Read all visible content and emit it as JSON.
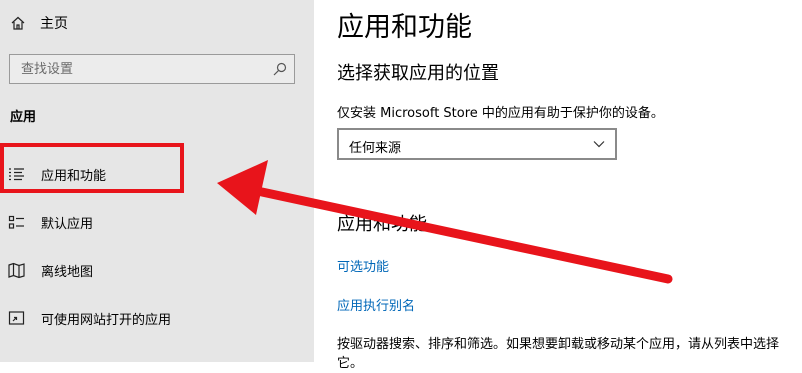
{
  "sidebar": {
    "home": {
      "label": "主页",
      "icon": "home-icon"
    },
    "search": {
      "placeholder": "查找设置",
      "icon": "search-icon"
    },
    "section_title": "应用",
    "items": [
      {
        "label": "应用和功能",
        "icon": "apps-features-icon",
        "selected": true
      },
      {
        "label": "默认应用",
        "icon": "default-apps-icon"
      },
      {
        "label": "离线地图",
        "icon": "offline-maps-icon"
      },
      {
        "label": "可使用网站打开的应用",
        "icon": "apps-for-websites-icon"
      }
    ]
  },
  "main": {
    "title": "应用和功能",
    "install_location": {
      "heading": "选择获取应用的位置",
      "description": "仅安装 Microsoft Store 中的应用有助于保护你的设备。",
      "dropdown_value": "任何来源"
    },
    "apps_section": {
      "heading": "应用和功能",
      "links": [
        "可选功能",
        "应用执行别名"
      ],
      "description": "按驱动器搜索、排序和筛选。如果想要卸载或移动某个应用，请从列表中选择它。"
    }
  },
  "annotation": {
    "highlight_color": "#e8141b",
    "arrow_color": "#e8141b"
  }
}
